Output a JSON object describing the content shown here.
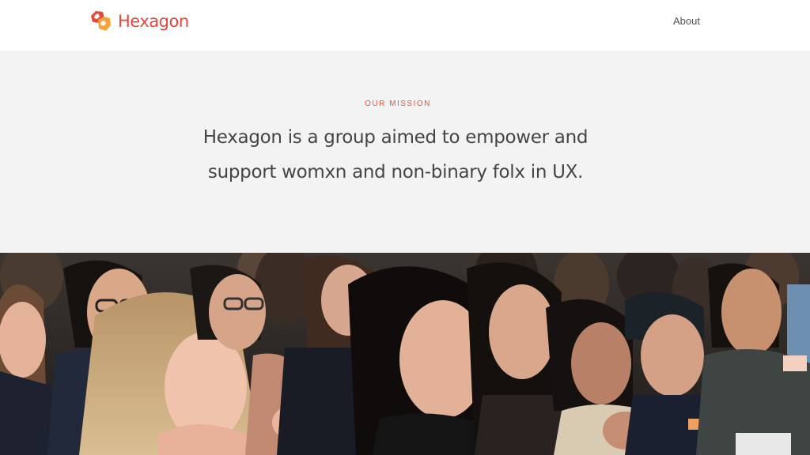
{
  "brand": {
    "name": "Hexagon",
    "icon": "hexagon-logo-icon",
    "colors": {
      "primary": "#e8453c",
      "secondary": "#f7a23a"
    }
  },
  "nav": {
    "items": [
      {
        "label": "About"
      }
    ]
  },
  "mission": {
    "eyebrow": "OUR MISSION",
    "statement": "Hexagon is a group aimed to empower and support womxn and non-binary folx in UX.",
    "eyebrow_color": "#e8553e",
    "background": "#f3f3f3"
  },
  "hero": {
    "image": "audience-photo",
    "description_visible": false
  }
}
